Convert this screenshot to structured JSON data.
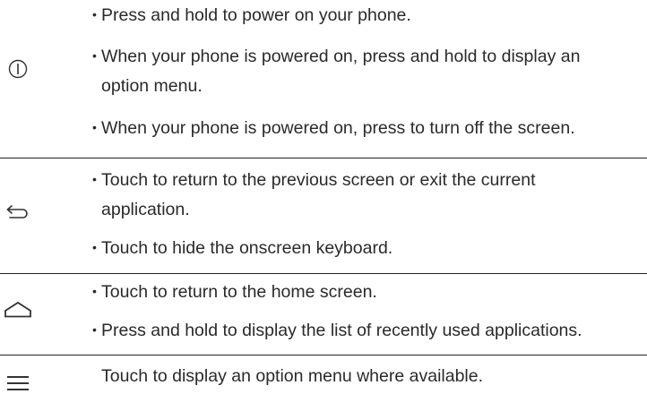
{
  "rows": [
    {
      "icon": "power-icon",
      "items": [
        "Press and hold to power on your phone.",
        "When your phone is powered on, press and hold to display an",
        "option menu.",
        "When your phone is powered on, press to turn off the screen."
      ]
    },
    {
      "icon": "back-icon",
      "items": [
        "Touch to return to the previous screen or exit the current",
        "application.",
        "Touch to hide the onscreen keyboard."
      ]
    },
    {
      "icon": "home-icon",
      "items": [
        "Touch to return to the home screen.",
        "Press and hold to display the list of recently used applications."
      ]
    },
    {
      "icon": "menu-icon",
      "items": [
        "Touch to display an option menu where available."
      ]
    }
  ],
  "bullet_char": "•"
}
